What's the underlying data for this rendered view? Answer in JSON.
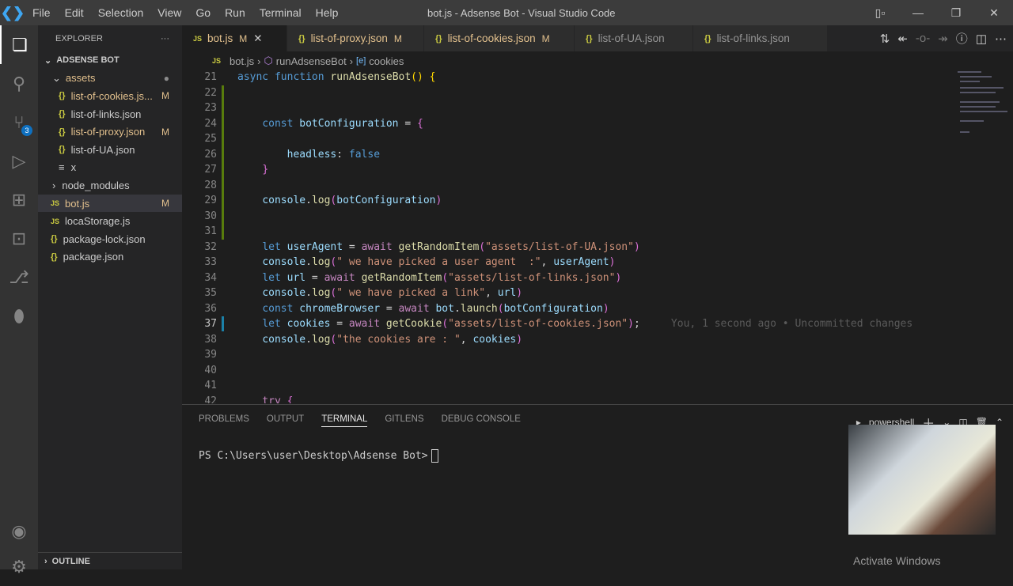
{
  "titlebar": {
    "menu": [
      "File",
      "Edit",
      "Selection",
      "View",
      "Go",
      "Run",
      "Terminal",
      "Help"
    ],
    "title": "bot.js - Adsense Bot - Visual Studio Code"
  },
  "activity": {
    "scm_badge": "3"
  },
  "explorer": {
    "header": "EXPLORER",
    "more": "···",
    "project": "ADSENSE BOT",
    "items": [
      {
        "label": "assets",
        "type": "folder-open",
        "depth": 1,
        "mark": "●"
      },
      {
        "label": "list-of-cookies.js...",
        "type": "json",
        "depth": 2,
        "mark": "M"
      },
      {
        "label": "list-of-links.json",
        "type": "json",
        "depth": 2,
        "mark": ""
      },
      {
        "label": "list-of-proxy.json",
        "type": "json",
        "depth": 2,
        "mark": "M"
      },
      {
        "label": "list-of-UA.json",
        "type": "json",
        "depth": 2,
        "mark": ""
      },
      {
        "label": "x",
        "type": "file",
        "depth": 2,
        "mark": ""
      },
      {
        "label": "node_modules",
        "type": "folder",
        "depth": 1,
        "mark": ""
      },
      {
        "label": "bot.js",
        "type": "js",
        "depth": 1,
        "mark": "M"
      },
      {
        "label": "locaStorage.js",
        "type": "js",
        "depth": 1,
        "mark": ""
      },
      {
        "label": "package-lock.json",
        "type": "json",
        "depth": 1,
        "mark": ""
      },
      {
        "label": "package.json",
        "type": "json",
        "depth": 1,
        "mark": ""
      }
    ],
    "outline": "OUTLINE"
  },
  "tabs": [
    {
      "label": "bot.js",
      "type": "js",
      "mark": "M",
      "active": true
    },
    {
      "label": "list-of-proxy.json",
      "type": "json",
      "mark": "M"
    },
    {
      "label": "list-of-cookies.json",
      "type": "json",
      "mark": "M"
    },
    {
      "label": "list-of-UA.json",
      "type": "json",
      "mark": ""
    },
    {
      "label": "list-of-links.json",
      "type": "json",
      "mark": ""
    }
  ],
  "breadcrumb": [
    "bot.js",
    "runAdsenseBot",
    "cookies"
  ],
  "code": [
    {
      "n": "21",
      "t": [
        [
          "kw",
          "async "
        ],
        [
          "kw",
          "function "
        ],
        [
          "fn",
          "runAdsenseBot"
        ],
        [
          "br",
          "() {"
        ]
      ]
    },
    {
      "n": "22",
      "t": []
    },
    {
      "n": "23",
      "t": []
    },
    {
      "n": "24",
      "t": [
        [
          "pl",
          "    "
        ],
        [
          "kw",
          "const "
        ],
        [
          "id",
          "botConfiguration"
        ],
        [
          "pl",
          " = "
        ],
        [
          "br2",
          "{"
        ]
      ]
    },
    {
      "n": "25",
      "t": []
    },
    {
      "n": "26",
      "t": [
        [
          "pl",
          "        "
        ],
        [
          "id",
          "headless"
        ],
        [
          "pl",
          ": "
        ],
        [
          "kw",
          "false"
        ]
      ]
    },
    {
      "n": "27",
      "t": [
        [
          "pl",
          "    "
        ],
        [
          "br2",
          "}"
        ]
      ]
    },
    {
      "n": "28",
      "t": []
    },
    {
      "n": "29",
      "t": [
        [
          "pl",
          "    "
        ],
        [
          "id",
          "console"
        ],
        [
          "pl",
          "."
        ],
        [
          "fn",
          "log"
        ],
        [
          "br2",
          "("
        ],
        [
          "id",
          "botConfiguration"
        ],
        [
          "br2",
          ")"
        ]
      ]
    },
    {
      "n": "30",
      "t": []
    },
    {
      "n": "31",
      "t": []
    },
    {
      "n": "32",
      "t": [
        [
          "pl",
          "    "
        ],
        [
          "kw",
          "let "
        ],
        [
          "id",
          "userAgent"
        ],
        [
          "pl",
          " = "
        ],
        [
          "kc",
          "await "
        ],
        [
          "fn",
          "getRandomItem"
        ],
        [
          "br2",
          "("
        ],
        [
          "str",
          "\"assets/list-of-UA.json\""
        ],
        [
          "br2",
          ")"
        ]
      ]
    },
    {
      "n": "33",
      "t": [
        [
          "pl",
          "    "
        ],
        [
          "id",
          "console"
        ],
        [
          "pl",
          "."
        ],
        [
          "fn",
          "log"
        ],
        [
          "br2",
          "("
        ],
        [
          "str",
          "\" we have picked a user agent  :\""
        ],
        [
          "pl",
          ", "
        ],
        [
          "id",
          "userAgent"
        ],
        [
          "br2",
          ")"
        ]
      ]
    },
    {
      "n": "34",
      "t": [
        [
          "pl",
          "    "
        ],
        [
          "kw",
          "let "
        ],
        [
          "id",
          "url"
        ],
        [
          "pl",
          " = "
        ],
        [
          "kc",
          "await "
        ],
        [
          "fn",
          "getRandomItem"
        ],
        [
          "br2",
          "("
        ],
        [
          "str",
          "\"assets/list-of-links.json\""
        ],
        [
          "br2",
          ")"
        ]
      ]
    },
    {
      "n": "35",
      "t": [
        [
          "pl",
          "    "
        ],
        [
          "id",
          "console"
        ],
        [
          "pl",
          "."
        ],
        [
          "fn",
          "log"
        ],
        [
          "br2",
          "("
        ],
        [
          "str",
          "\" we have picked a link\""
        ],
        [
          "pl",
          ", "
        ],
        [
          "id",
          "url"
        ],
        [
          "br2",
          ")"
        ]
      ]
    },
    {
      "n": "36",
      "t": [
        [
          "pl",
          "    "
        ],
        [
          "kw",
          "const "
        ],
        [
          "id",
          "chromeBrowser"
        ],
        [
          "pl",
          " = "
        ],
        [
          "kc",
          "await "
        ],
        [
          "id",
          "bot"
        ],
        [
          "pl",
          "."
        ],
        [
          "fn",
          "launch"
        ],
        [
          "br2",
          "("
        ],
        [
          "id",
          "botConfiguration"
        ],
        [
          "br2",
          ")"
        ]
      ]
    },
    {
      "n": "37",
      "t": [
        [
          "pl",
          "    "
        ],
        [
          "kw",
          "let "
        ],
        [
          "id",
          "cookies"
        ],
        [
          "pl",
          " = "
        ],
        [
          "kc",
          "await "
        ],
        [
          "fn",
          "getCookie"
        ],
        [
          "br2",
          "("
        ],
        [
          "str",
          "\"assets/list-of-cookies.json\""
        ],
        [
          "br2",
          ")"
        ],
        [
          "pl",
          ";"
        ],
        [
          "blame",
          "     You, 1 second ago • Uncommitted changes"
        ]
      ],
      "cur": true
    },
    {
      "n": "38",
      "t": [
        [
          "pl",
          "    "
        ],
        [
          "id",
          "console"
        ],
        [
          "pl",
          "."
        ],
        [
          "fn",
          "log"
        ],
        [
          "br2",
          "("
        ],
        [
          "str",
          "\"the cookies are : \""
        ],
        [
          "pl",
          ", "
        ],
        [
          "id",
          "cookies"
        ],
        [
          "br2",
          ")"
        ]
      ]
    },
    {
      "n": "39",
      "t": []
    },
    {
      "n": "40",
      "t": []
    },
    {
      "n": "41",
      "t": []
    },
    {
      "n": "42",
      "t": [
        [
          "pl",
          "    "
        ],
        [
          "kc",
          "try "
        ],
        [
          "br2",
          "{"
        ]
      ]
    }
  ],
  "panel": {
    "tabs": [
      "PROBLEMS",
      "OUTPUT",
      "TERMINAL",
      "GITLENS",
      "DEBUG CONSOLE"
    ],
    "active": "TERMINAL",
    "shell": "powershell",
    "prompt": "PS C:\\Users\\user\\Desktop\\Adsense Bot>"
  },
  "watermark": "Activate Windows"
}
